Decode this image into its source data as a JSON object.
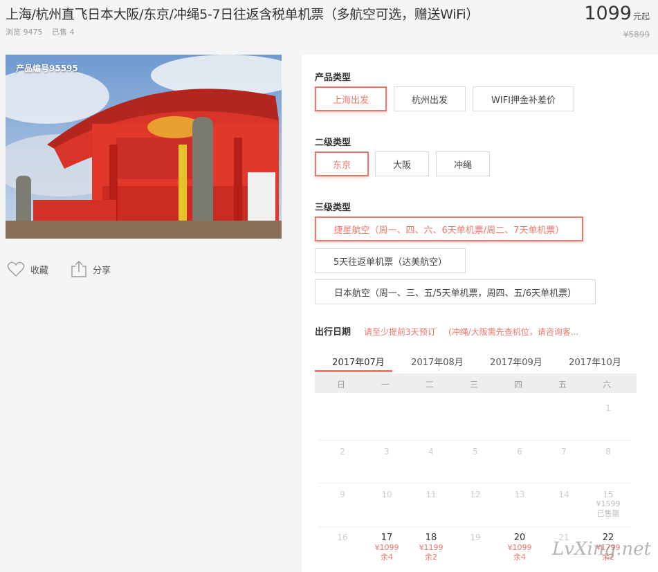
{
  "product": {
    "title": "上海/杭州直飞日本大阪/东京/冲绳5-7日往返含税单机票（多航空可选，赠送WiFi）",
    "views": "浏览 9475",
    "sold": "已售 4",
    "price": "1099",
    "price_unit": "元起",
    "original_price": "¥5899",
    "code": "产品编号95595"
  },
  "actions": {
    "favorite": "收藏",
    "share": "分享"
  },
  "options": {
    "type1_label": "产品类型",
    "type1": [
      "上海出发",
      "杭州出发",
      "WIFI押金补差价"
    ],
    "type2_label": "二级类型",
    "type2": [
      "东京",
      "大阪",
      "冲绳"
    ],
    "type3_label": "三级类型",
    "type3": [
      "捷星航空（周一、四、六、6天单机票/周二、7天单机票）",
      "5天往返单机票（达美航空）",
      "日本航空（周一、三、五/5天单机票，周四、五/6天单机票）"
    ]
  },
  "date": {
    "label": "出行日期",
    "hint1": "请至少提前3天预订",
    "hint2": "(冲绳/大阪需先查机位，请咨询客...",
    "months": [
      "2017年07月",
      "2017年08月",
      "2017年09月",
      "2017年10月"
    ],
    "weekdays": [
      "日",
      "一",
      "二",
      "三",
      "四",
      "五",
      "六"
    ],
    "rows": [
      [
        "",
        "",
        "",
        "",
        "",
        "",
        "1"
      ],
      [
        "2",
        "3",
        "4",
        "5",
        "6",
        "7",
        "8"
      ],
      [
        "9",
        "10",
        "11",
        "12",
        "13",
        "14",
        "15"
      ],
      [
        "16",
        "17",
        "18",
        "19",
        "20",
        "21",
        "22"
      ]
    ],
    "d15": {
      "price": "¥1599",
      "stock": "已售罄"
    },
    "d17": {
      "price": "¥1099",
      "stock": "余4"
    },
    "d18": {
      "price": "¥1199",
      "stock": "余2"
    },
    "d20": {
      "price": "¥1099",
      "stock": "余4"
    },
    "d22": {
      "price": "¥1799",
      "stock": "余2"
    }
  },
  "watermark": "LvXing.net",
  "colors": {
    "accent": "#e9786a",
    "panel": "#ffffff",
    "page": "#f5f5f5"
  }
}
